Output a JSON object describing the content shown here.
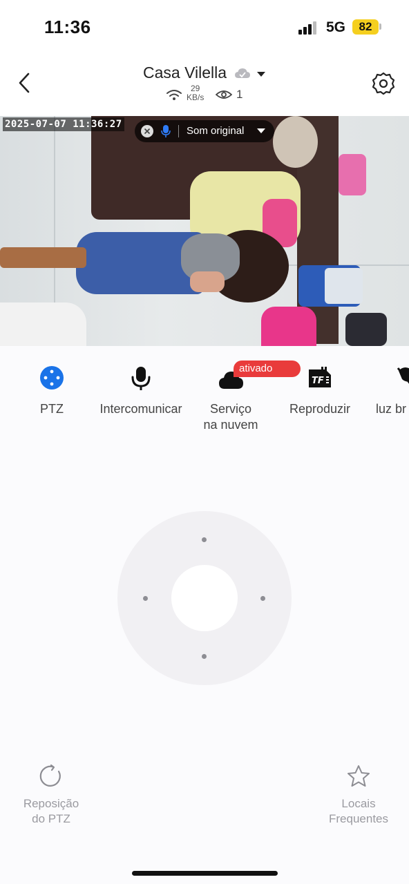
{
  "status_bar": {
    "time": "11:36",
    "network": "5G",
    "battery": "82",
    "battery_color": "#f5cf1f"
  },
  "header": {
    "back_icon": "chevron-left-icon",
    "title": "Casa Vilella",
    "cloud_icon": "cloud-badge-icon",
    "speed_value": "29",
    "speed_unit": "KB/s",
    "viewers": "1",
    "settings_icon": "gear-icon"
  },
  "video": {
    "timestamp": "2025-07-07 11:36:27",
    "audio_label": "Som original"
  },
  "toolbar": {
    "accent_color": "#1a73e8",
    "items": [
      {
        "label": "PTZ",
        "icon": "ptz-joystick-icon",
        "active": true
      },
      {
        "label": "Intercomunicar",
        "icon": "microphone-icon"
      },
      {
        "label": "Serviço\nna nuvem",
        "icon": "cloud-icon",
        "badge": "ativado",
        "badge_color": "#e93b3b"
      },
      {
        "label": "Reproduzir",
        "icon": "tf-card-icon"
      },
      {
        "label": "luz br",
        "icon": "light-off-icon"
      }
    ]
  },
  "ptz": {
    "reset_label_line1": "Reposição",
    "reset_label_line2": "do PTZ",
    "favorites_label_line1": "Locais",
    "favorites_label_line2": "Frequentes"
  }
}
